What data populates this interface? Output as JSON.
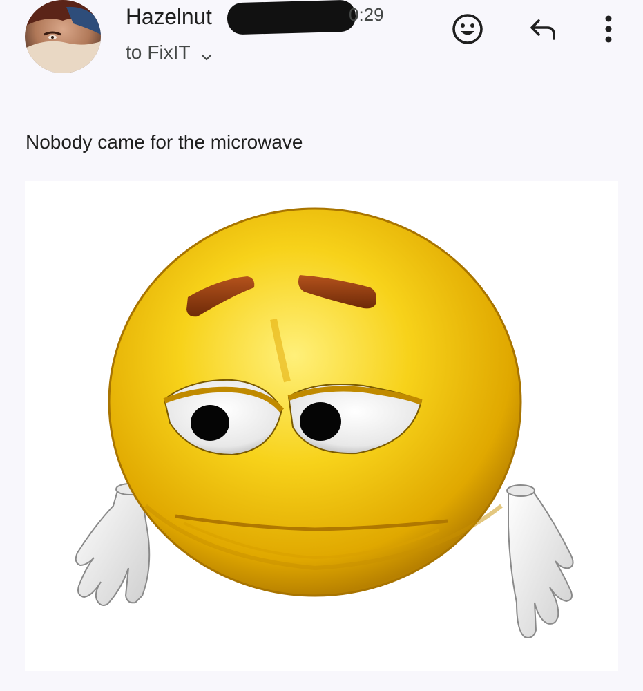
{
  "message": {
    "sender_name": "Hazelnut",
    "time": "0:29",
    "recipient_prefix": "to",
    "recipient": "FixIT",
    "body": "Nobody came for the microwave"
  },
  "actions": {
    "react": "smiley-icon",
    "reply": "reply-icon",
    "more": "more-vert-icon"
  },
  "colors": {
    "background": "#f8f7fc",
    "text_primary": "#1f1f1f",
    "text_secondary": "#444746",
    "emoji_yellow": "#f4c400",
    "eyebrow": "#8a3a10"
  }
}
